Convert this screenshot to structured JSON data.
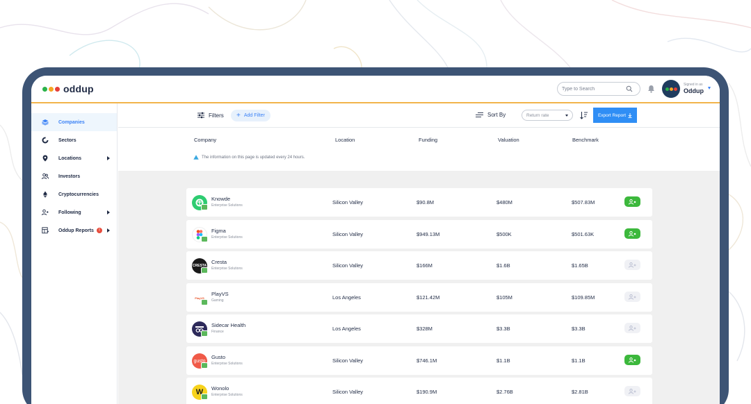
{
  "brand": {
    "name": "oddup",
    "dots": [
      "#2bb34a",
      "#f5a623",
      "#e5403a"
    ]
  },
  "search": {
    "placeholder": "Type to Search"
  },
  "user": {
    "signed_in_label": "Signed in as",
    "name": "Oddup"
  },
  "sidebar": {
    "items": [
      {
        "label": "Companies",
        "icon": "layers-icon",
        "active": true,
        "has_arrow": false
      },
      {
        "label": "Sectors",
        "icon": "donut-icon",
        "active": false,
        "has_arrow": false
      },
      {
        "label": "Locations",
        "icon": "map-pin-icon",
        "active": false,
        "has_arrow": true
      },
      {
        "label": "Investors",
        "icon": "users-icon",
        "active": false,
        "has_arrow": false
      },
      {
        "label": "Cryptocurrencies",
        "icon": "ethereum-icon",
        "active": false,
        "has_arrow": false
      },
      {
        "label": "Following",
        "icon": "user-follow-icon",
        "active": false,
        "has_arrow": true
      },
      {
        "label": "Oddup Reports",
        "icon": "report-icon",
        "active": false,
        "has_arrow": true,
        "badge": "!"
      }
    ]
  },
  "toolbar": {
    "filters_label": "Filters",
    "add_filter_label": "Add Filter",
    "sort_by_label": "Sort By",
    "sort_select_value": "Return rate",
    "export_label": "Export Report"
  },
  "columns": [
    "Company",
    "Location",
    "Funding",
    "Valuation",
    "Benchmark"
  ],
  "notice": "The information on this page is updated every 24 hours.",
  "companies": [
    {
      "name": "Knowde",
      "sector": "Enterprise Solutions",
      "location": "Silicon Valley",
      "funding": "$90.8M",
      "valuation": "$480M",
      "benchmark": "$507.83M",
      "following": true,
      "logo_bg": "#2ecc71",
      "logo_text": ""
    },
    {
      "name": "Figma",
      "sector": "Enterprise Solutions",
      "location": "Silicon Valley",
      "funding": "$949.13M",
      "valuation": "$500K",
      "benchmark": "$501.63K",
      "following": true,
      "logo_bg": "#ffffff",
      "logo_text": ""
    },
    {
      "name": "Cresta",
      "sector": "Enterprise Solutions",
      "location": "Silicon Valley",
      "funding": "$166M",
      "valuation": "$1.6B",
      "benchmark": "$1.65B",
      "following": false,
      "logo_bg": "#1a1a1a",
      "logo_text": "CRESTA"
    },
    {
      "name": "PlayVS",
      "sector": "Gaming",
      "location": "Los Angeles",
      "funding": "$121.42M",
      "valuation": "$105M",
      "benchmark": "$109.85M",
      "following": false,
      "logo_bg": "#ffffff",
      "logo_text": "PlayVS"
    },
    {
      "name": "Sidecar Health",
      "sector": "Finance",
      "location": "Los Angeles",
      "funding": "$328M",
      "valuation": "$3.3B",
      "benchmark": "$3.3B",
      "following": false,
      "logo_bg": "#2d2a5a",
      "logo_text": ""
    },
    {
      "name": "Gusto",
      "sector": "Enterprise Solutions",
      "location": "Silicon Valley",
      "funding": "$746.1M",
      "valuation": "$1.1B",
      "benchmark": "$1.1B",
      "following": true,
      "logo_bg": "#f05a48",
      "logo_text": "gusto"
    },
    {
      "name": "Wonolo",
      "sector": "Enterprise Solutions",
      "location": "Silicon Valley",
      "funding": "$190.9M",
      "valuation": "$2.76B",
      "benchmark": "$2.81B",
      "following": false,
      "logo_bg": "#f7d21c",
      "logo_text": "W"
    }
  ]
}
